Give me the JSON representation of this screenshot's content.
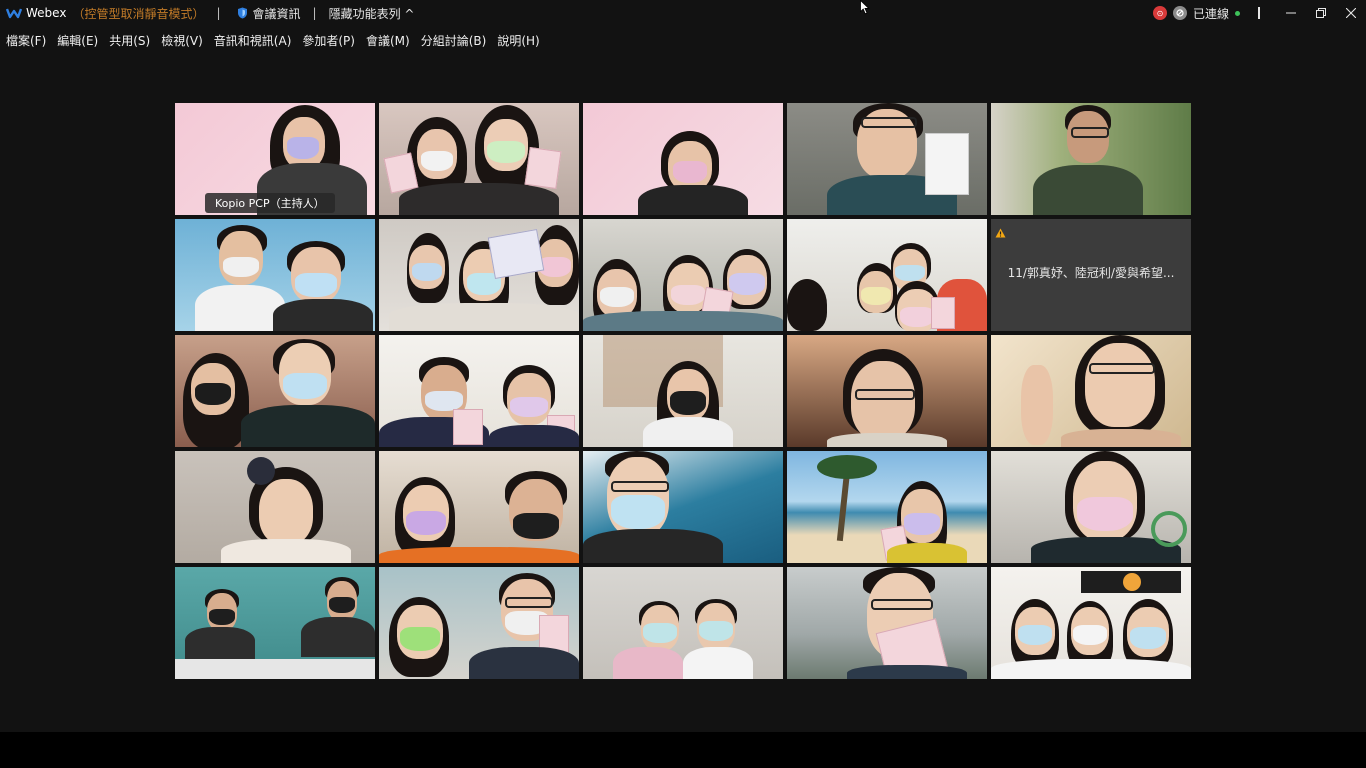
{
  "titlebar": {
    "app_name": "Webex",
    "mode": "（控管型取消靜音模式）",
    "separator": "|",
    "meeting_info": "會議資訊",
    "hide_menu": "隱藏功能表列 ^",
    "recording_badge": "⊙",
    "connection_status": "已連線",
    "colors": {
      "mode_text": "#c27b28",
      "connected_dot": "#3ec25a",
      "recording": "#d93a3a"
    }
  },
  "menubar": {
    "items": [
      {
        "label": "檔案(F)"
      },
      {
        "label": "編輯(E)"
      },
      {
        "label": "共用(S)"
      },
      {
        "label": "檢視(V)"
      },
      {
        "label": "音訊和視訊(A)"
      },
      {
        "label": "參加者(P)"
      },
      {
        "label": "會議(M)"
      },
      {
        "label": "分組討論(B)"
      },
      {
        "label": "說明(H)"
      }
    ]
  },
  "grid": {
    "host_label": "Kopio PCP（主持人）",
    "no_video_participant": "11/郭真妤、陸冠利/愛與希望...",
    "active_color": "#3aa9e8"
  }
}
